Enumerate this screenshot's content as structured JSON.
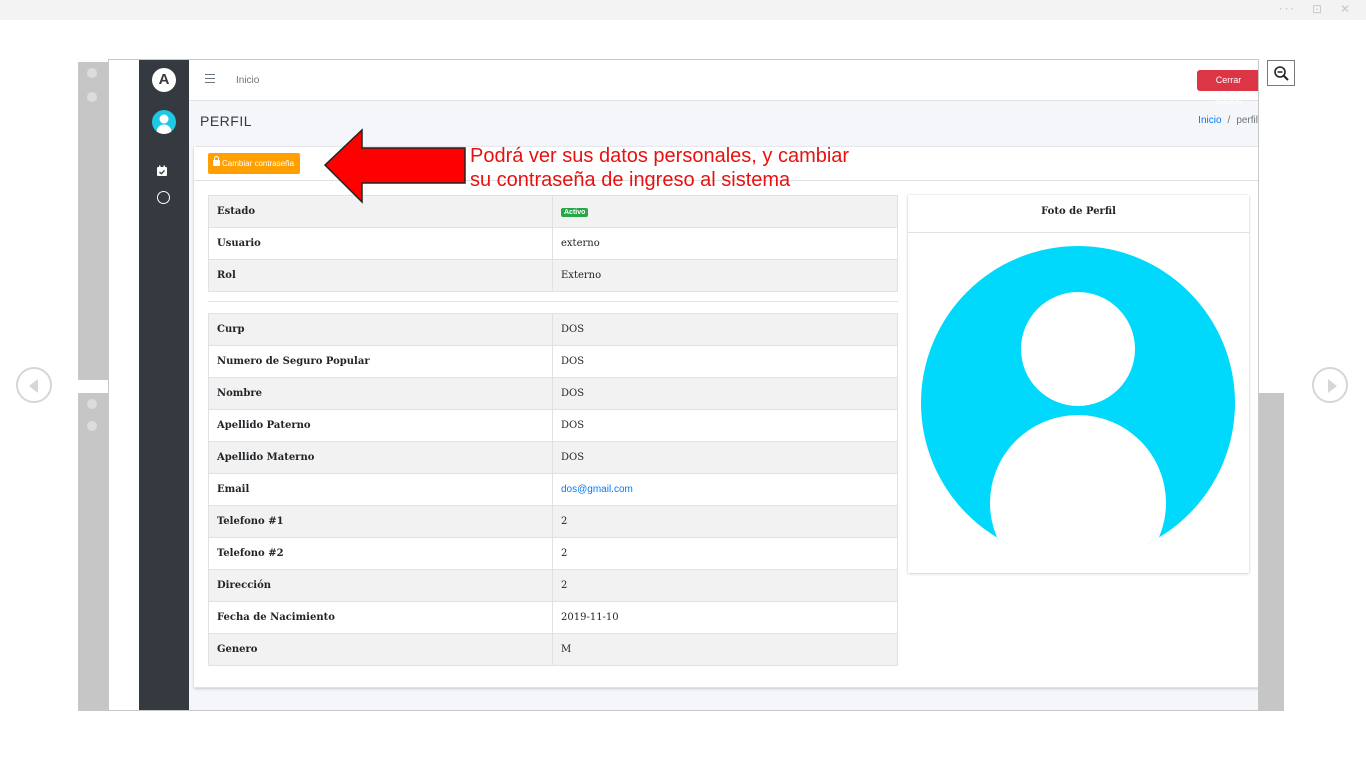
{
  "app": {
    "logo_letter": "A",
    "nav_link": "Inicio",
    "logout_label": "Cerrar Sesión"
  },
  "page": {
    "title": "PERFIL",
    "breadcrumb": {
      "home": "Inicio",
      "separator": "/",
      "current": "perfil"
    }
  },
  "toolbar": {
    "change_password_label": "Cambiar contraseña"
  },
  "account_table": [
    {
      "label": "Estado",
      "value": "Activo"
    },
    {
      "label": "Usuario",
      "value": "externo"
    },
    {
      "label": "Rol",
      "value": "Externo"
    }
  ],
  "personal_table": [
    {
      "label": "Curp",
      "value": "DOS"
    },
    {
      "label": "Numero de Seguro Popular",
      "value": "DOS"
    },
    {
      "label": "Nombre",
      "value": "DOS"
    },
    {
      "label": "Apellido Paterno",
      "value": "DOS"
    },
    {
      "label": "Apellido Materno",
      "value": "DOS"
    },
    {
      "label": "Email",
      "value": "dos@gmail.com"
    },
    {
      "label": "Telefono #1",
      "value": "2"
    },
    {
      "label": "Telefono #2",
      "value": "2"
    },
    {
      "label": "Dirección",
      "value": "2"
    },
    {
      "label": "Fecha de Nacimiento",
      "value": "2019-11-10"
    },
    {
      "label": "Genero",
      "value": "M"
    }
  ],
  "photo": {
    "title": "Foto de Perfil",
    "avatar_color": "#00d8fc"
  },
  "annotation": {
    "line1": "Podrá ver sus datos personales, y cambiar",
    "line2": "su contraseña de ingreso al sistema",
    "color": "#e8110f"
  },
  "colors": {
    "sidebar": "#343a40",
    "danger": "#dc3545",
    "warning": "#ffa000",
    "success": "#28a745",
    "link": "#007bff"
  },
  "icons": [
    "hamburger-icon",
    "lock-icon",
    "calendar-check-icon",
    "circle-icon",
    "user-avatar-icon",
    "zoom-out-icon",
    "chevron-left-icon",
    "chevron-right-icon"
  ]
}
